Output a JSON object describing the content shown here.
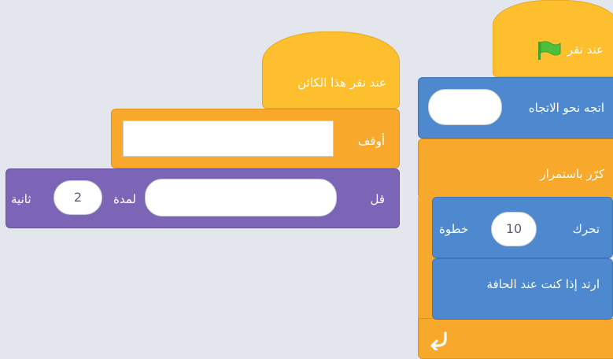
{
  "script_right": {
    "hat": {
      "label": "عند نقر"
    },
    "point": {
      "label": "اتجه نحو الاتجاه"
    },
    "forever": {
      "label": "كرّر باستمرار"
    },
    "move": {
      "label": "تحرك",
      "value": "10",
      "suffix": "خطوة"
    },
    "bounce": {
      "label": "ارتد إذا كنت عند الحافة"
    }
  },
  "script_left": {
    "hat": {
      "label": "عند نقر هذا الكائن"
    },
    "stop": {
      "label": "أوقف"
    },
    "say": {
      "label": "قل",
      "duration_label": "لمدة",
      "seconds": "2",
      "unit": "ثانية"
    }
  },
  "colors": {
    "events": "#fdbf2e",
    "control": "#f8a92b",
    "motion": "#4e88cf",
    "looks": "#7c65b6",
    "flag": "#4cbf3b",
    "background": "#e3e6ed"
  },
  "icons": [
    "green-flag-icon",
    "loop-arrow-icon"
  ]
}
